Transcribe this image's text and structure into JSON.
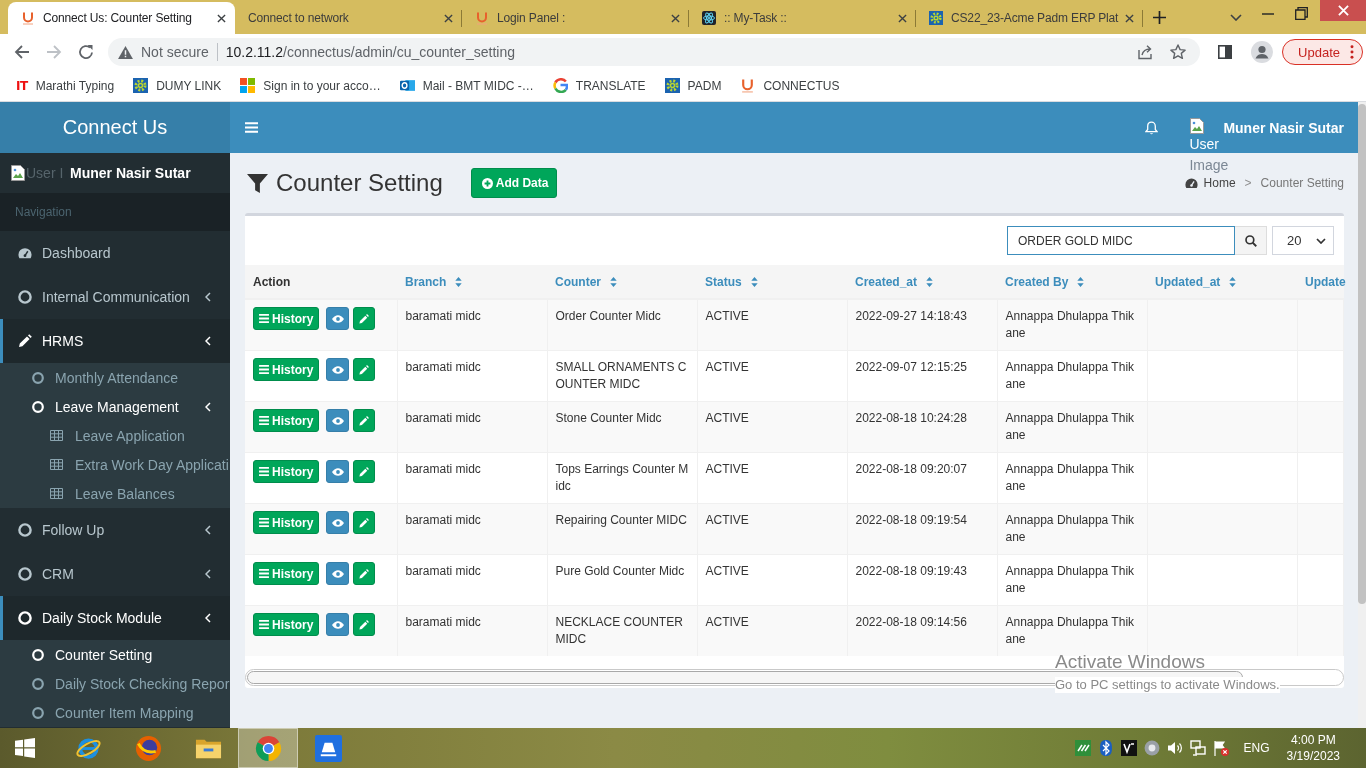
{
  "browser": {
    "tabs": [
      {
        "title": "Connect Us: Counter Setting",
        "kind": "connectus",
        "selected": true
      },
      {
        "title": "Connect to network",
        "kind": "none",
        "selected": false
      },
      {
        "title": "Login Panel :",
        "kind": "connectus",
        "selected": false
      },
      {
        "title": ":: My-Task ::",
        "kind": "atom",
        "selected": false
      },
      {
        "title": "CS22_23-Acme Padm ERP Plat",
        "kind": "gear",
        "selected": false
      }
    ],
    "address": {
      "security": "Not secure",
      "host": "10.2.11.2",
      "path": "/connectus/admin/cu_counter_setting"
    },
    "update_button": "Update",
    "bookmarks": [
      {
        "label": "Marathi Typing",
        "kind": "text",
        "icon_text": "IT"
      },
      {
        "label": "DUMY LINK",
        "kind": "gear"
      },
      {
        "label": "Sign in to your acco…",
        "kind": "tiles"
      },
      {
        "label": "Mail - BMT MIDC -…",
        "kind": "mail"
      },
      {
        "label": "TRANSLATE",
        "kind": "ring"
      },
      {
        "label": "PADM",
        "kind": "gear"
      },
      {
        "label": "CONNECTUS",
        "kind": "connectus"
      }
    ]
  },
  "app": {
    "brand": "Connect Us",
    "navbar": {
      "user_image_alt": "User Image",
      "user_name": "Muner Nasir Sutar"
    },
    "sidebar": {
      "user_image_alt": "User I",
      "user_name": "Muner Nasir Sutar",
      "header": "Navigation",
      "menu": [
        {
          "label": "Dashboard",
          "kind": "dashboard",
          "expanded": false
        },
        {
          "label": "Internal Communication",
          "kind": "tree",
          "expanded": false
        },
        {
          "label": "HRMS",
          "kind": "pencil",
          "expanded": true,
          "children": [
            {
              "label": "Monthly Attendance",
              "selected": false
            },
            {
              "label": "Leave Management",
              "selected": true,
              "children": [
                {
                  "label": "Leave Application",
                  "selected": false
                },
                {
                  "label": "Extra Work Day Applicati",
                  "selected": false
                },
                {
                  "label": "Leave Balances",
                  "selected": false
                }
              ]
            }
          ]
        },
        {
          "label": "Follow Up",
          "kind": "tree",
          "expanded": false
        },
        {
          "label": "CRM",
          "kind": "tree",
          "expanded": false
        },
        {
          "label": "Daily Stock Module",
          "kind": "tree",
          "expanded": true,
          "children": [
            {
              "label": "Counter Setting",
              "selected": true
            },
            {
              "label": "Daily Stock Checking Repor",
              "selected": false
            },
            {
              "label": "Counter Item Mapping",
              "selected": false
            }
          ]
        }
      ]
    },
    "content": {
      "title": "Counter Setting",
      "add_button": "Add Data",
      "breadcrumb": {
        "items": [
          "Home",
          "Counter Setting"
        ],
        "separator": ">"
      },
      "search": {
        "value": "ORDER GOLD MIDC"
      },
      "page_size": "20",
      "table": {
        "columns": [
          {
            "label": "Action",
            "link": false,
            "sortable": false
          },
          {
            "label": "Branch",
            "link": true,
            "sortable": true
          },
          {
            "label": "Counter",
            "link": true,
            "sortable": true
          },
          {
            "label": "Status",
            "link": true,
            "sortable": true
          },
          {
            "label": "Created_at",
            "link": true,
            "sortable": true
          },
          {
            "label": "Created By",
            "link": true,
            "sortable": true
          },
          {
            "label": "Updated_at",
            "link": true,
            "sortable": true
          },
          {
            "label": "Update",
            "link": true,
            "sortable": false
          }
        ],
        "rows": [
          {
            "history": "History",
            "branch": "baramati midc",
            "counter": "Order Counter Midc",
            "status": "ACTIVE",
            "created_at": "2022-09-27 14:18:43",
            "created_by": "Annappa Dhulappa Thikane"
          },
          {
            "history": "History",
            "branch": "baramati midc",
            "counter": "SMALL ORNAMENTS COUNTER MIDC",
            "status": "ACTIVE",
            "created_at": "2022-09-07 12:15:25",
            "created_by": "Annappa Dhulappa Thikane"
          },
          {
            "history": "History",
            "branch": "baramati midc",
            "counter": "Stone Counter Midc",
            "status": "ACTIVE",
            "created_at": "2022-08-18 10:24:28",
            "created_by": "Annappa Dhulappa Thikane"
          },
          {
            "history": "History",
            "branch": "baramati midc",
            "counter": "Tops Earrings Counter Midc",
            "status": "ACTIVE",
            "created_at": "2022-08-18 09:20:07",
            "created_by": "Annappa Dhulappa Thikane"
          },
          {
            "history": "History",
            "branch": "baramati midc",
            "counter": "Repairing Counter MIDC",
            "status": "ACTIVE",
            "created_at": "2022-08-18 09:19:54",
            "created_by": "Annappa Dhulappa Thikane"
          },
          {
            "history": "History",
            "branch": "baramati midc",
            "counter": "Pure Gold Counter Midc",
            "status": "ACTIVE",
            "created_at": "2022-08-18 09:19:43",
            "created_by": "Annappa Dhulappa Thikane"
          },
          {
            "history": "History",
            "branch": "baramati midc",
            "counter": "NECKLACE COUNTER MIDC",
            "status": "ACTIVE",
            "created_at": "2022-08-18 09:14:56",
            "created_by": "Annappa Dhulappa Thikane"
          }
        ]
      }
    }
  },
  "os_notice": {
    "title": "Activate Windows",
    "text": "Go to PC settings to activate Windows."
  },
  "taskbar": {
    "apps": [
      {
        "kind": "orbit",
        "selected": false
      },
      {
        "kind": "globe",
        "selected": false
      },
      {
        "kind": "folder",
        "selected": false
      },
      {
        "kind": "wheel",
        "selected": true
      },
      {
        "kind": "tile",
        "selected": false
      }
    ],
    "language": "ENG",
    "time": "4:00 PM",
    "date": "3/19/2023"
  }
}
